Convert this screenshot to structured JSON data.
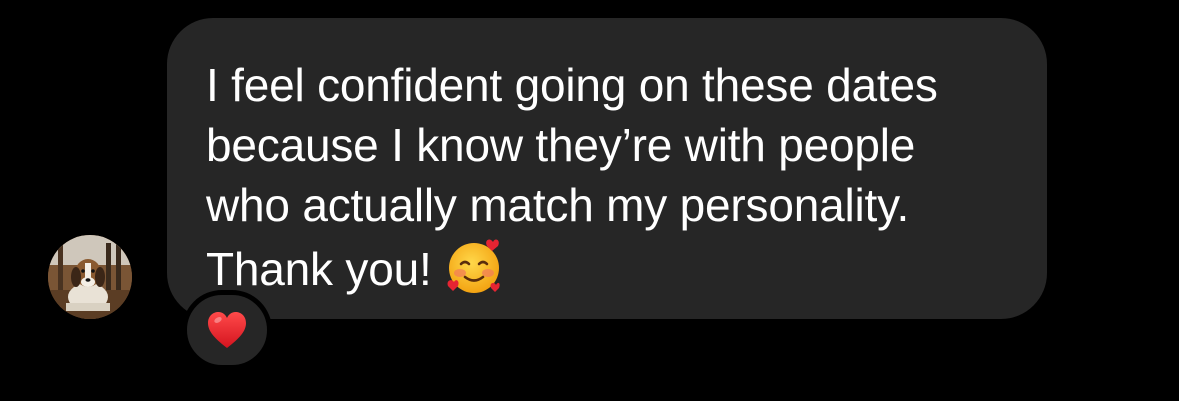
{
  "message": {
    "lines": [
      "I feel confident going on these dates",
      "because I know they’re with people",
      "who actually match my personality.",
      "Thank you!"
    ],
    "emoji": "smiling-face-with-hearts-emoji"
  },
  "sender": {
    "avatar": "dog-photo-avatar"
  },
  "reaction": {
    "icon": "red-heart-icon",
    "color": "#e8202a"
  },
  "colors": {
    "background": "#000000",
    "bubble": "#262626",
    "text": "#ffffff"
  }
}
